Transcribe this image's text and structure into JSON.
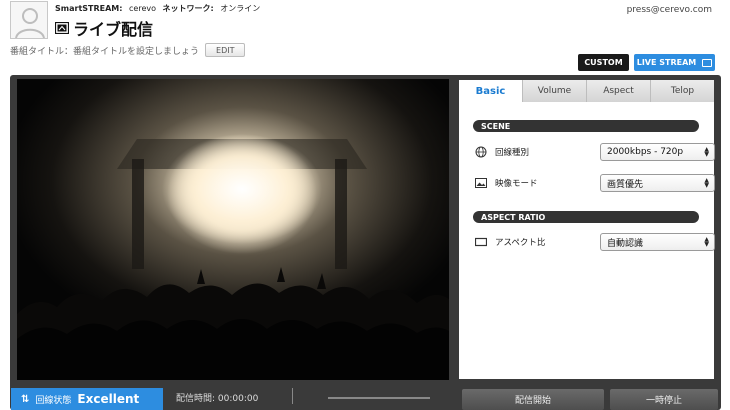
{
  "header": {
    "service": "SmartSTREAM:",
    "account": "cerevo",
    "network_label": "ネットワーク:",
    "network_status": "オンライン",
    "title": "ライブ配信",
    "email": "press@cerevo.com",
    "live_icon": "live-broadcast-icon",
    "avatar_icon": "default-avatar-icon"
  },
  "program": {
    "label": "番組タイトル：番組タイトルを設定しましょう",
    "edit_label": "EDIT"
  },
  "mode_buttons": {
    "custom_label": "CUSTOM",
    "live_stream_label": "LIVE STREAM",
    "live_stream_icon": "popout-window-icon"
  },
  "settings": {
    "tabs": [
      {
        "label": "Basic",
        "active": true
      },
      {
        "label": "Volume",
        "active": false
      },
      {
        "label": "Aspect",
        "active": false
      },
      {
        "label": "Telop",
        "active": false
      }
    ],
    "scene": {
      "heading": "SCENE",
      "line_type": {
        "label": "回線種別",
        "value": "2000kbps - 720p",
        "icon": "globe-icon"
      },
      "video_mode": {
        "label": "映像モード",
        "value": "画質優先",
        "icon": "image-icon"
      }
    },
    "aspect_ratio": {
      "heading": "ASPECT RATIO",
      "aspect": {
        "label": "アスペクト比",
        "value": "自動認識",
        "icon": "screen-icon"
      }
    }
  },
  "footer": {
    "connection_label": "回線状態",
    "connection_value": "Excellent",
    "connection_icon": "up-down-arrows-icon",
    "duration_label": "配信時間:",
    "duration_value": "00:00:00",
    "start_label": "配信開始",
    "pause_label": "一時停止"
  },
  "colors": {
    "accent": "#2d8de0",
    "console_bg": "#3a3a3a",
    "custom_bg": "#1a1a1a"
  }
}
